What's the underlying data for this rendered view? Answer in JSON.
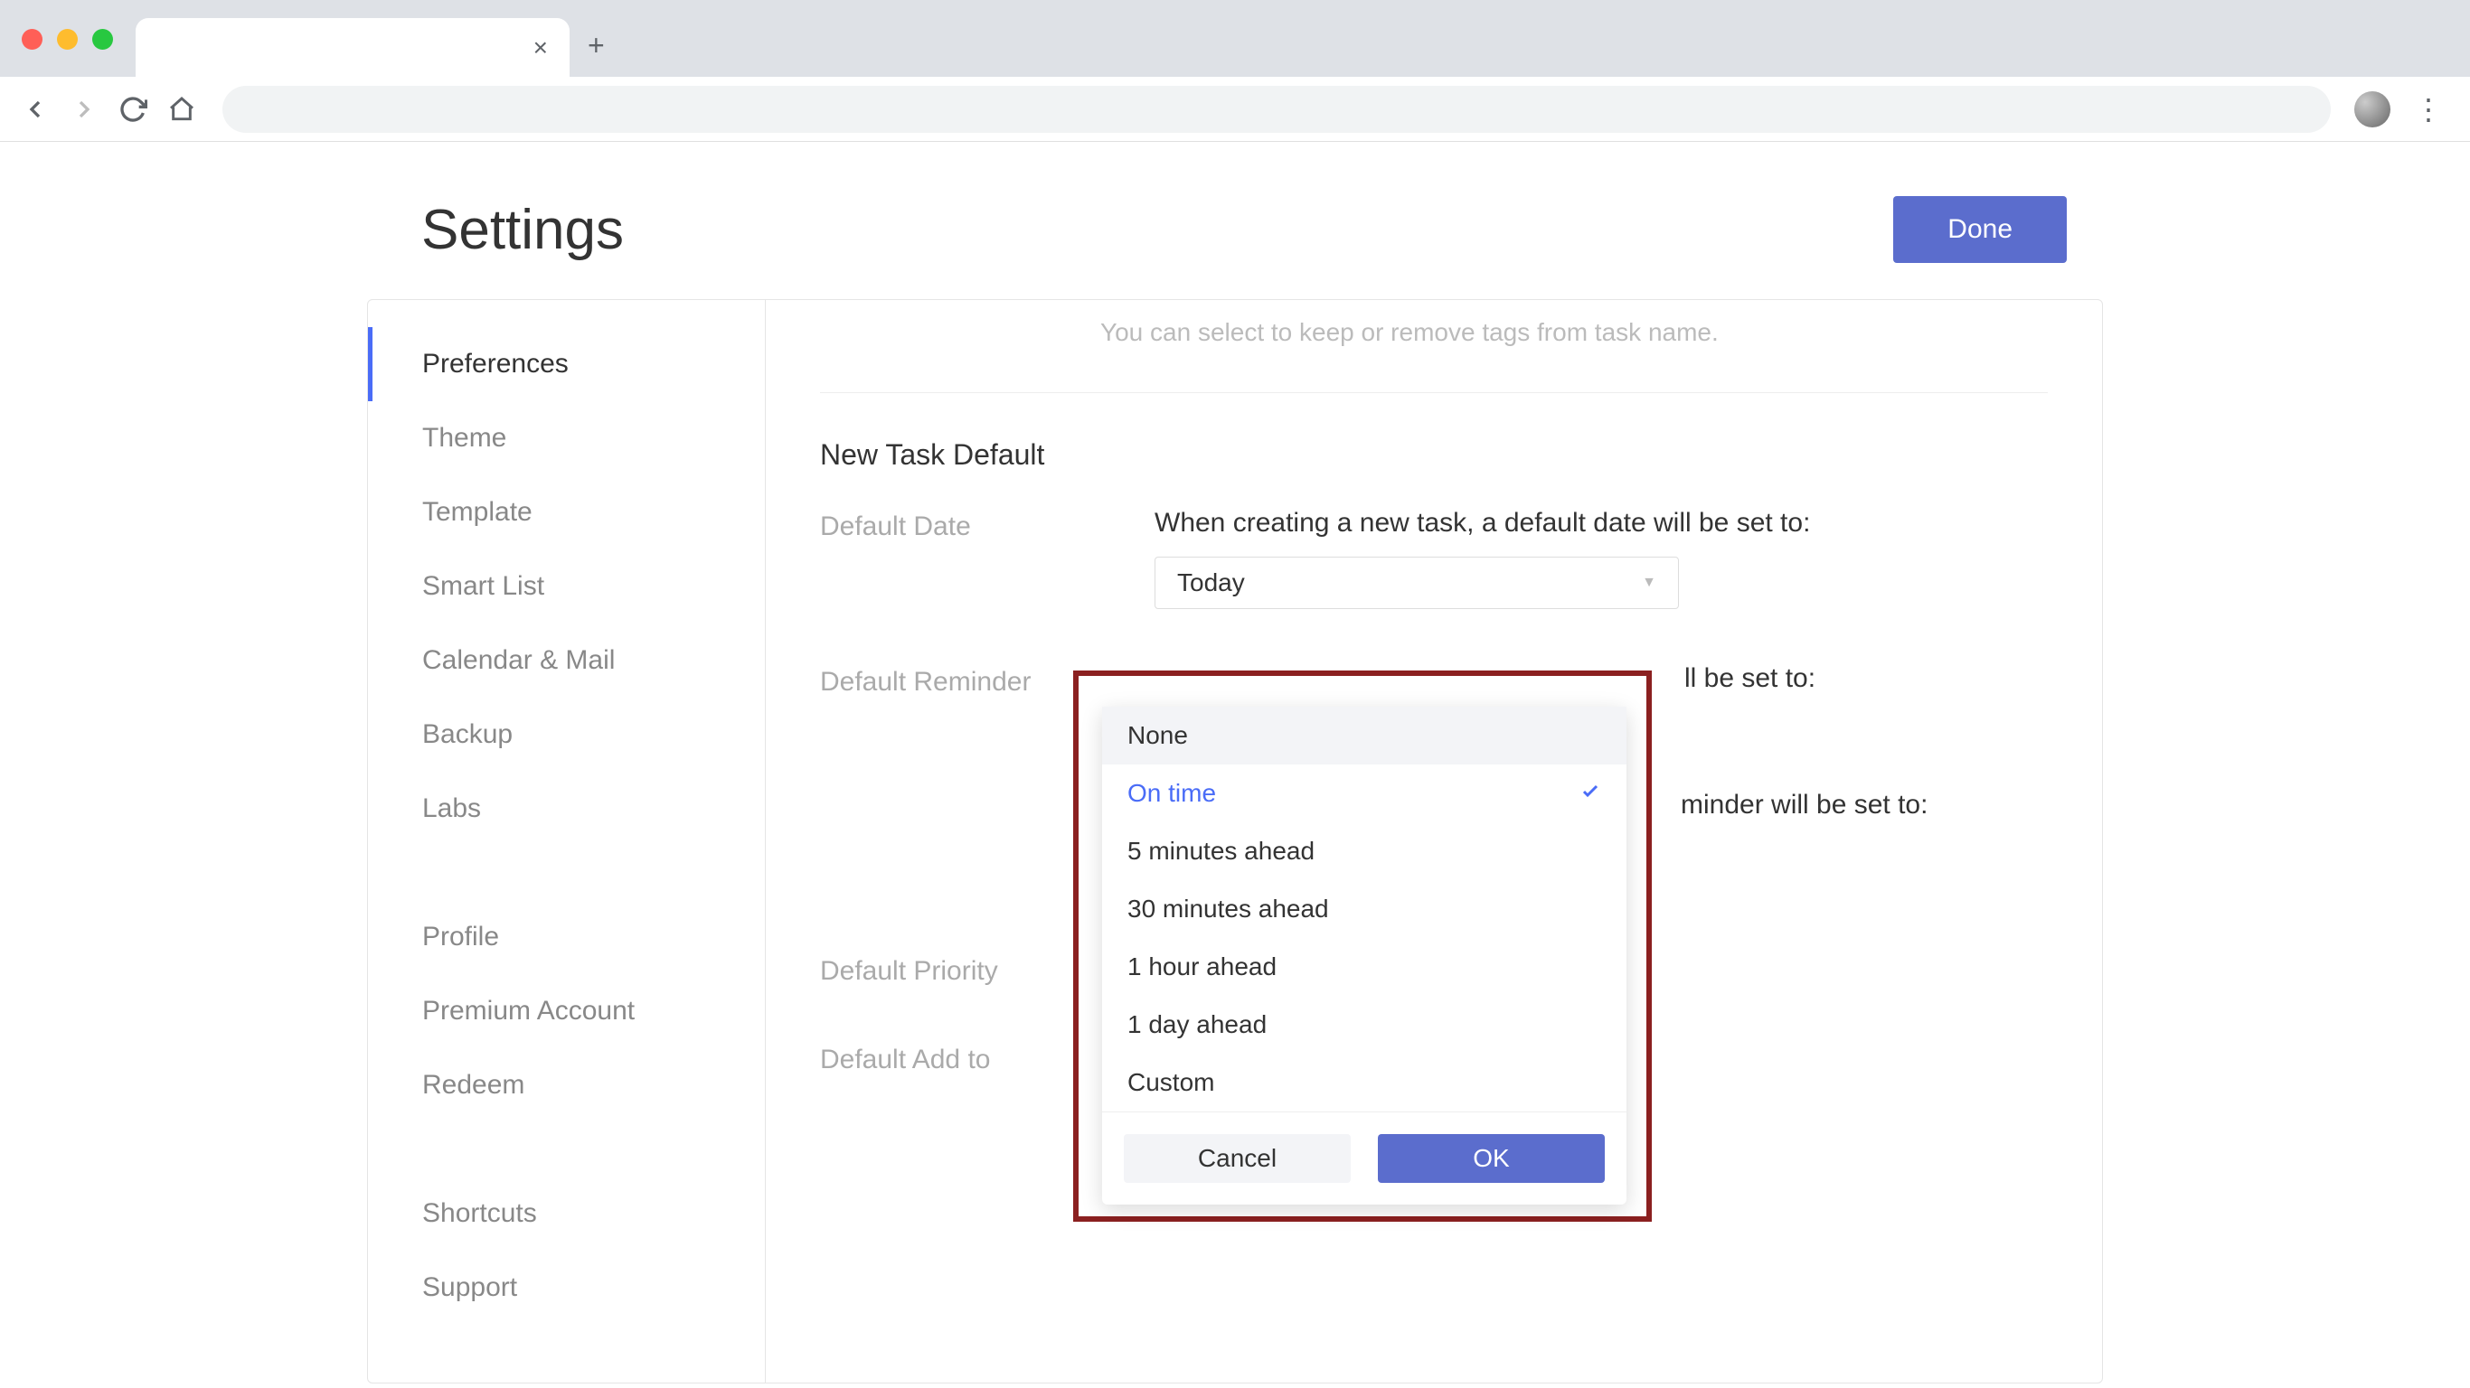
{
  "page": {
    "title": "Settings",
    "done": "Done"
  },
  "sidebar": {
    "group1": [
      "Preferences",
      "Theme",
      "Template",
      "Smart List",
      "Calendar & Mail",
      "Backup",
      "Labs"
    ],
    "group2": [
      "Profile",
      "Premium Account",
      "Redeem"
    ],
    "group3": [
      "Shortcuts",
      "Support"
    ]
  },
  "main": {
    "hint": "You can select to keep or remove tags from task name.",
    "section_title": "New Task Default",
    "default_date": {
      "label": "Default Date",
      "desc": "When creating a new task, a default date will be set to:",
      "value": "Today"
    },
    "default_reminder": {
      "label": "Default Reminder",
      "desc_tail1": "ll be set to:",
      "desc_tail2": "minder will be set to:"
    },
    "default_priority": {
      "label": "Default Priority"
    },
    "default_addto": {
      "label": "Default Add to"
    }
  },
  "dropdown": {
    "items": [
      "None",
      "On time",
      "5 minutes ahead",
      "30 minutes ahead",
      "1 hour ahead",
      "1 day ahead",
      "Custom"
    ],
    "selected_index": 1,
    "hovered_index": 0,
    "cancel": "Cancel",
    "ok": "OK"
  }
}
